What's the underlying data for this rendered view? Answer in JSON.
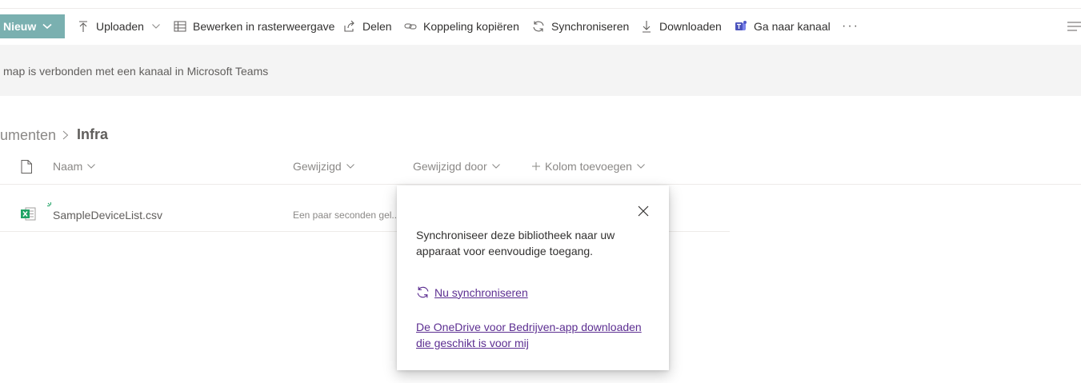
{
  "commandbar": {
    "new_label": "Nieuw",
    "upload_label": "Uploaden",
    "grid_edit_label": "Bewerken in rasterweergave",
    "share_label": "Delen",
    "copy_link_label": "Koppeling kopiëren",
    "sync_label": "Synchroniseren",
    "download_label": "Downloaden",
    "go_to_channel_label": "Ga naar kanaal",
    "more_label": "···"
  },
  "banner": {
    "text": "map is verbonden met een kanaal in Microsoft Teams"
  },
  "breadcrumb": {
    "parent": "umenten",
    "current": "Infra"
  },
  "columns": {
    "name": "Naam",
    "modified": "Gewijzigd",
    "modified_by": "Gewijzigd door",
    "add_column": "Kolom toevoegen"
  },
  "files": [
    {
      "name": "SampleDeviceList.csv",
      "modified": "Een paar seconden gel..."
    }
  ],
  "popup": {
    "message": "Synchroniseer deze bibliotheek naar uw apparaat voor eenvoudige toegang.",
    "sync_now": " Nu synchroniseren",
    "onedrive_link": "De OneDrive voor Bedrijven-app downloaden die geschikt is voor mij"
  },
  "colors": {
    "new_button": "#7ab0b0",
    "link": "#5c2e91",
    "banner_bg": "#f4f4f4"
  }
}
